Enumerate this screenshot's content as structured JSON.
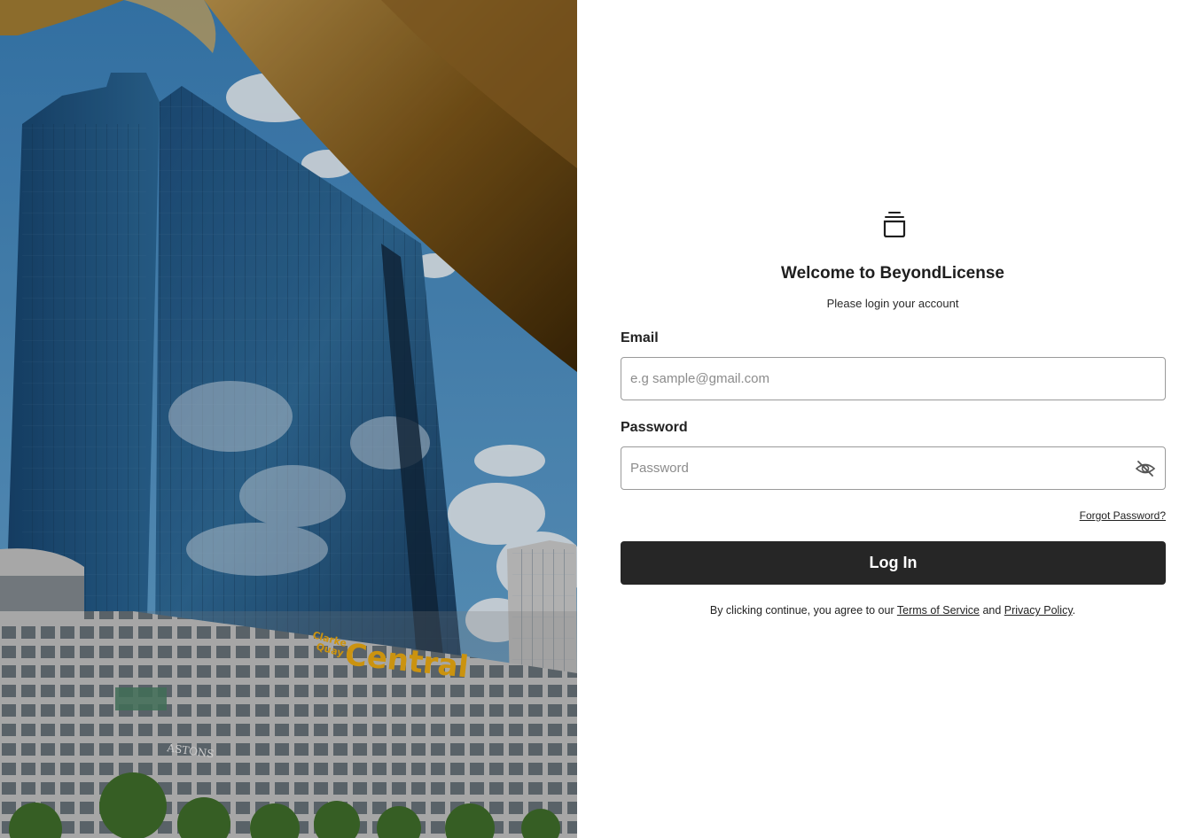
{
  "brand": {
    "icon": "stacked-cup-icon",
    "welcome_text": "Welcome to BeyondLicense",
    "subtitle": "Please login your account"
  },
  "form": {
    "email_label": "Email",
    "email_placeholder": "e.g sample@gmail.com",
    "email_value": "",
    "password_label": "Password",
    "password_placeholder": "Password",
    "password_value": "",
    "password_toggle_icon": "eye-off-icon",
    "forgot_password": "Forgot Password?",
    "login_button": "Log In"
  },
  "legal": {
    "prefix": "By clicking continue, you agree to our ",
    "terms_link": "Terms of Service",
    "and": " and ",
    "privacy_link": "Privacy Policy",
    "suffix": "."
  },
  "photo": {
    "signage": {
      "building_name": "Central",
      "small_sign_line1": "Clarke",
      "small_sign_line2": "Quay",
      "store_sign": "ASTONS"
    }
  },
  "colors": {
    "button_bg": "#262626",
    "button_text": "#ffffff",
    "input_border": "#9a9a9a",
    "sky": "#4a8cbf",
    "sign_yellow": "#e8a812"
  }
}
